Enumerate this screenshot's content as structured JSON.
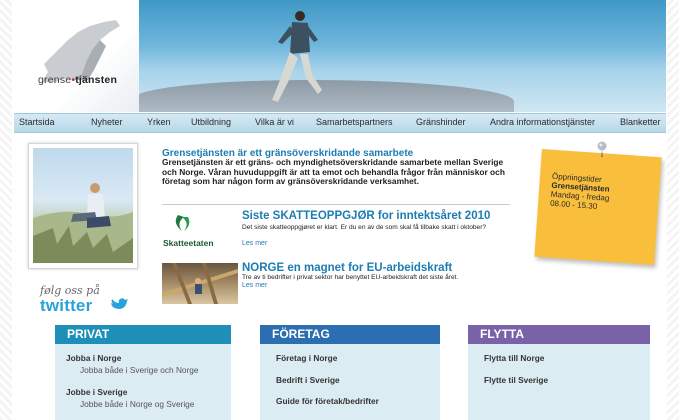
{
  "logo": {
    "name_part1": "grense",
    "dot": "•",
    "name_part2": "tjänsten"
  },
  "nav": {
    "items": [
      "Startsida",
      "Nyheter",
      "Yrken",
      "Utbildning",
      "Vilka är vi",
      "Samarbetspartners",
      "Gränshinder",
      "Andra informationstjänster",
      "Blanketter"
    ]
  },
  "social": {
    "follow_text": "følg oss på",
    "twitter_label": "twitter"
  },
  "intro": {
    "title": "Grensetjänsten är ett gränsöverskridande samarbete",
    "text": "Grensetjänsten är ett gräns- och myndighetsöverskridande samarbete mellan Sverige och Norge. Våran huvuduppgift är att ta emot och behandla frågor från människor och företag som har någon form av gränsöverskridande verksamhet."
  },
  "news": [
    {
      "logo_label": "Skatteetaten",
      "title": "Siste SKATTEOPPGJØR for inntektsåret 2010",
      "text": "Det siste skatteoppgjøret er klart. Er du en av de som skal få tilbake skatt i oktober?",
      "more": "Les mer"
    },
    {
      "title": "NORGE en magnet for EU-arbeidskraft",
      "text": "Tre av ti bedrifter i privat sektor har benyttet EU-arbeidskraft det siste året.",
      "more": "Les mer"
    }
  ],
  "opening": {
    "label": "Öppningstider",
    "name": "Grensetjänsten",
    "days": "Mandag - fredag",
    "hours": "08.00 - 15.30"
  },
  "sections": [
    {
      "title": "PRIVAT",
      "color": "#1d8fb8",
      "links": [
        {
          "label": "Jobba i Norge",
          "sub": "Jobba både i Sverige och Norge"
        },
        {
          "label": "Jobbe i Sverige",
          "sub": "Jobbe både i Norge og Sverige"
        }
      ]
    },
    {
      "title": "FÖRETAG",
      "color": "#2b6fb2",
      "links": [
        {
          "label": "Företag i Norge"
        },
        {
          "label": "Bedrift i Sverige"
        },
        {
          "label": "Guide för företak/bedrifter"
        }
      ]
    },
    {
      "title": "FLYTTA",
      "color": "#7a62a8",
      "links": [
        {
          "label": "Flytta till Norge"
        },
        {
          "label": "Flytte til Sverige"
        }
      ]
    }
  ],
  "colors": {
    "accent": "#1b7db2",
    "note": "#f9bf3c",
    "twitter": "#27a3d7"
  }
}
